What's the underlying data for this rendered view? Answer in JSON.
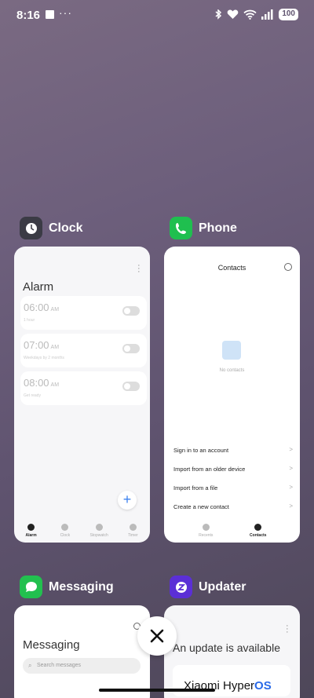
{
  "status": {
    "time": "8:16",
    "battery": "100"
  },
  "apps": {
    "clock": {
      "name": "Clock",
      "title": "Alarm",
      "alarms": [
        {
          "time": "06:00",
          "ampm": "AM",
          "sub": "1 hour"
        },
        {
          "time": "07:00",
          "ampm": "AM",
          "sub": "Weekdays by 2 months"
        },
        {
          "time": "08:00",
          "ampm": "AM",
          "sub": "Get ready"
        }
      ],
      "nav": [
        "Alarm",
        "Clock",
        "Stopwatch",
        "Timer"
      ]
    },
    "phone": {
      "name": "Phone",
      "title": "Contacts",
      "empty": "No contacts",
      "actions": [
        "Sign in to an account",
        "Import from an older device",
        "Import from a file",
        "Create a new contact"
      ],
      "nav": [
        "Recents",
        "Contacts"
      ]
    },
    "messaging": {
      "name": "Messaging",
      "title": "Messaging",
      "search_placeholder": "Search messages"
    },
    "updater": {
      "name": "Updater",
      "title": "An update is available",
      "brand_a": "Xiaomi Hyper",
      "brand_b": "OS"
    }
  },
  "colors": {
    "clock_icon": "#3b3b45",
    "phone_icon": "#1fbf4f",
    "messaging_icon": "#22c04f",
    "updater_icon": "#5b2fd6"
  }
}
